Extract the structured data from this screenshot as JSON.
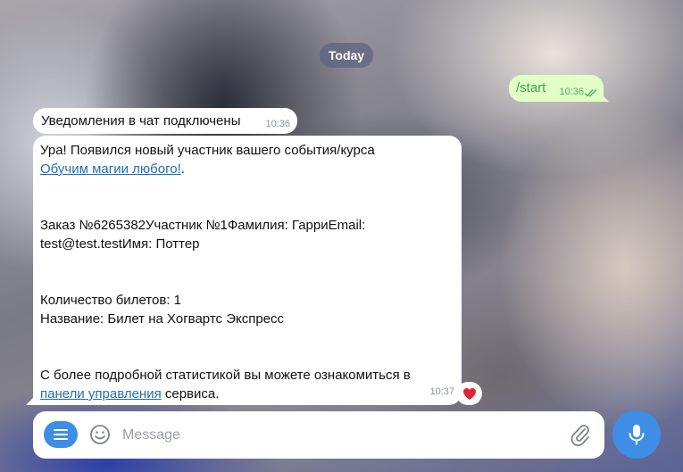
{
  "chat": {
    "date_label": "Today",
    "outgoing": {
      "text": "/start",
      "time": "10:36"
    },
    "incoming_1": {
      "text": "Уведомления в чат подключены",
      "time": "10:36"
    },
    "incoming_2": {
      "line1": "Ура! Появился новый участник вашего события/курса",
      "link1": "Обучим магии любого!",
      "link1_suffix": ".",
      "line2": "Заказ №6265382Участник №1Фамилия: ГарриEmail: test@test.testИмя: Поттер",
      "line3": "Количество билетов: 1",
      "line4": "Название: Билет на Хогвартс Экспресс",
      "line5": "С более подробной статистикой вы можете ознакомиться в",
      "link2": "панели управления",
      "link2_suffix": " сервиса.",
      "time": "10:37",
      "reaction": "❤️"
    }
  },
  "composer": {
    "placeholder": "Message"
  },
  "colors": {
    "accent": "#3e8ee6",
    "outgoing_bubble": "#e2ffc7",
    "link": "#1f6fb6"
  },
  "icons": {
    "menu": "menu-icon",
    "emoji": "emoji-icon",
    "attach": "paperclip-icon",
    "mic": "microphone-icon",
    "read": "double-check-icon",
    "reaction": "heart-icon"
  }
}
